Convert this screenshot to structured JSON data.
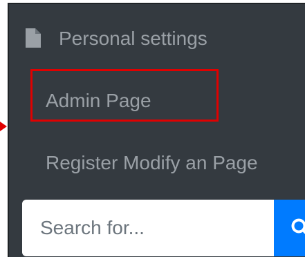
{
  "nav": {
    "items": [
      {
        "label": "Personal settings",
        "icon": "file-icon"
      },
      {
        "label": "Admin Page"
      },
      {
        "label": "Register Modify an Page"
      }
    ]
  },
  "search": {
    "placeholder": "Search for...",
    "icon": "search-icon"
  },
  "colors": {
    "panel_bg": "#343a40",
    "nav_text": "#9aa0a6",
    "highlight": "#e00000",
    "search_button": "#007bff"
  }
}
